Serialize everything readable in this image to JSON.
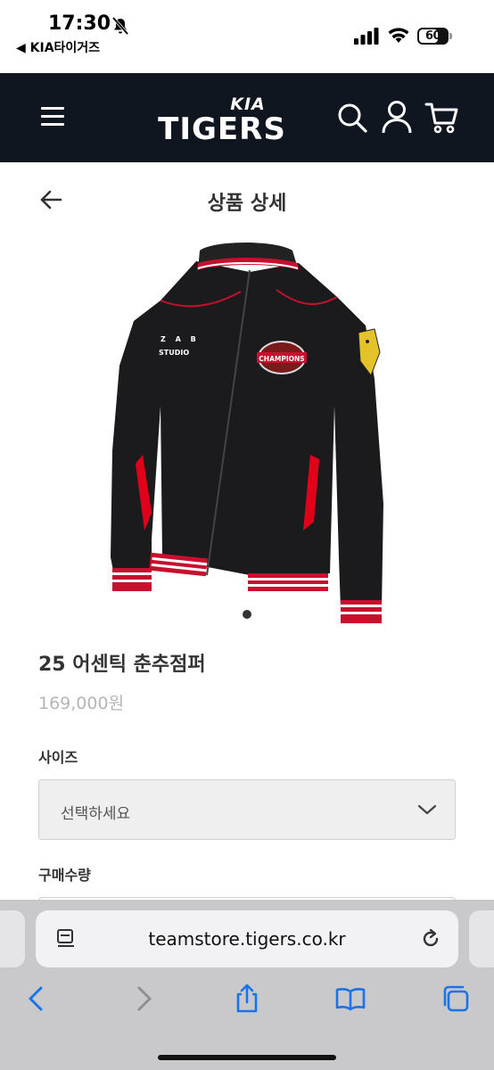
{
  "status": {
    "time": "17:30",
    "back_app": "◀ KIA타이거즈",
    "battery": "60"
  },
  "header": {
    "brand": "TIGERS",
    "brand_mark": "KIA",
    "colors": {
      "header_bg": "#0f1620",
      "logo": "#ffffff"
    },
    "icons": [
      "menu-icon",
      "search-icon",
      "user-icon",
      "cart-icon"
    ]
  },
  "page": {
    "title": "상품 상세",
    "back_icon": "back-arrow-icon"
  },
  "product": {
    "name": "25 어센틱 춘추점퍼",
    "price": "169,000원",
    "image_text": {
      "chest_logo": "Z A B",
      "chest_sub": "STUDIO",
      "patch": "CHAMPIONS"
    },
    "carousel_index": 1,
    "carousel_count": 1
  },
  "options": {
    "size_label": "사이즈",
    "size_value": "선택하세요",
    "quantity_label": "구매수량"
  },
  "browser": {
    "url": "teamstore.tigers.co.kr",
    "toolbar_icons": [
      "back-icon",
      "forward-icon",
      "share-icon",
      "bookmarks-icon",
      "tabs-icon"
    ]
  }
}
